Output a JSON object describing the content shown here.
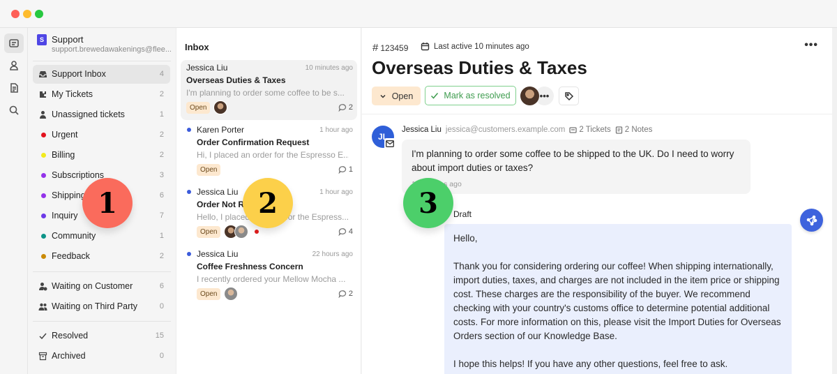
{
  "window": {
    "controls": [
      "close",
      "minimize",
      "zoom"
    ]
  },
  "rail": {
    "items": [
      {
        "name": "inbox-icon",
        "active": true
      },
      {
        "name": "contacts-icon",
        "active": false
      },
      {
        "name": "docs-icon",
        "active": false
      },
      {
        "name": "search-icon",
        "active": false
      }
    ]
  },
  "sidebar": {
    "account": {
      "logo": "S",
      "name": "Support",
      "email": "support.brewedawakenings@flee..."
    },
    "main_items": [
      {
        "label": "Support Inbox",
        "count": "4",
        "icon": "tray-icon",
        "active": true
      },
      {
        "label": "My Tickets",
        "count": "2",
        "icon": "puzzle-icon"
      },
      {
        "label": "Unassigned tickets",
        "count": "1",
        "icon": "user-icon"
      }
    ],
    "tags": [
      {
        "label": "Urgent",
        "count": "2",
        "color": "#e3121e"
      },
      {
        "label": "Billing",
        "count": "2",
        "color": "#f2ea1d"
      },
      {
        "label": "Subscriptions",
        "count": "3",
        "color": "#9333ea"
      },
      {
        "label": "Shipping",
        "count": "6",
        "color": "#9333ea"
      },
      {
        "label": "Inquiry",
        "count": "7",
        "color": "#6d3ae8"
      },
      {
        "label": "Community",
        "count": "1",
        "color": "#0d9488"
      },
      {
        "label": "Feedback",
        "count": "2",
        "color": "#ca8a04"
      }
    ],
    "waiting": [
      {
        "label": "Waiting on Customer",
        "count": "6",
        "icon": "user-clock-icon"
      },
      {
        "label": "Waiting on Third Party",
        "count": "0",
        "icon": "users-icon"
      }
    ],
    "status": [
      {
        "label": "Resolved",
        "count": "15",
        "icon": "check-icon"
      },
      {
        "label": "Archived",
        "count": "0",
        "icon": "archive-icon"
      }
    ]
  },
  "inbox": {
    "title": "Inbox",
    "conversations": [
      {
        "from": "Jessica Liu",
        "time": "10 minutes ago",
        "subject": "Overseas Duties & Taxes",
        "snippet": "I'm planning to order some coffee to be s...",
        "status": "Open",
        "comments": "2",
        "unread": false,
        "active": true
      },
      {
        "from": "Karen Porter",
        "time": "1 hour ago",
        "subject": "Order Confirmation Request",
        "snippet": "Hi, I placed an order for the Espresso E...",
        "status": "Open",
        "comments": "1",
        "unread": true
      },
      {
        "from": "Jessica Liu",
        "time": "1 hour ago",
        "subject": "Order Not Received",
        "snippet": "Hello, I placed an order for the Espress...",
        "status": "Open",
        "comments": "4",
        "unread": true
      },
      {
        "from": "Jessica Liu",
        "time": "22 hours ago",
        "subject": "Coffee Freshness Concern",
        "snippet": "I recently ordered your Mellow Mocha ...",
        "status": "Open",
        "comments": "2",
        "unread": true
      }
    ]
  },
  "detail": {
    "ticket_id": "123459",
    "last_active": "Last active 10 minutes ago",
    "title": "Overseas Duties & Taxes",
    "status_button": "Open",
    "resolve_button": "Mark as resolved",
    "more_label": "•••",
    "message": {
      "initials": "JL",
      "name": "Jessica Liu",
      "email": "jessica@customers.example.com",
      "tickets": "2 Tickets",
      "notes": "2 Notes",
      "body": "I'm planning to order some coffee to be shipped to the UK. Do I need to worry about import duties or taxes?",
      "time": "10 minutes ago"
    },
    "draft": {
      "label": "Draft",
      "body": "Hello,\n\nThank you for considering ordering our coffee! When shipping internationally, import duties, taxes, and charges are not included in the item price or shipping cost. These charges are the responsibility of the buyer. We recommend checking with your country's customs office to determine potential additional costs. For more information on this, please visit the Import Duties for Overseas Orders section of our Knowledge Base.\n\nI hope this helps! If you have any other questions, feel free to ask."
    }
  },
  "markers": [
    "1",
    "2",
    "3"
  ]
}
